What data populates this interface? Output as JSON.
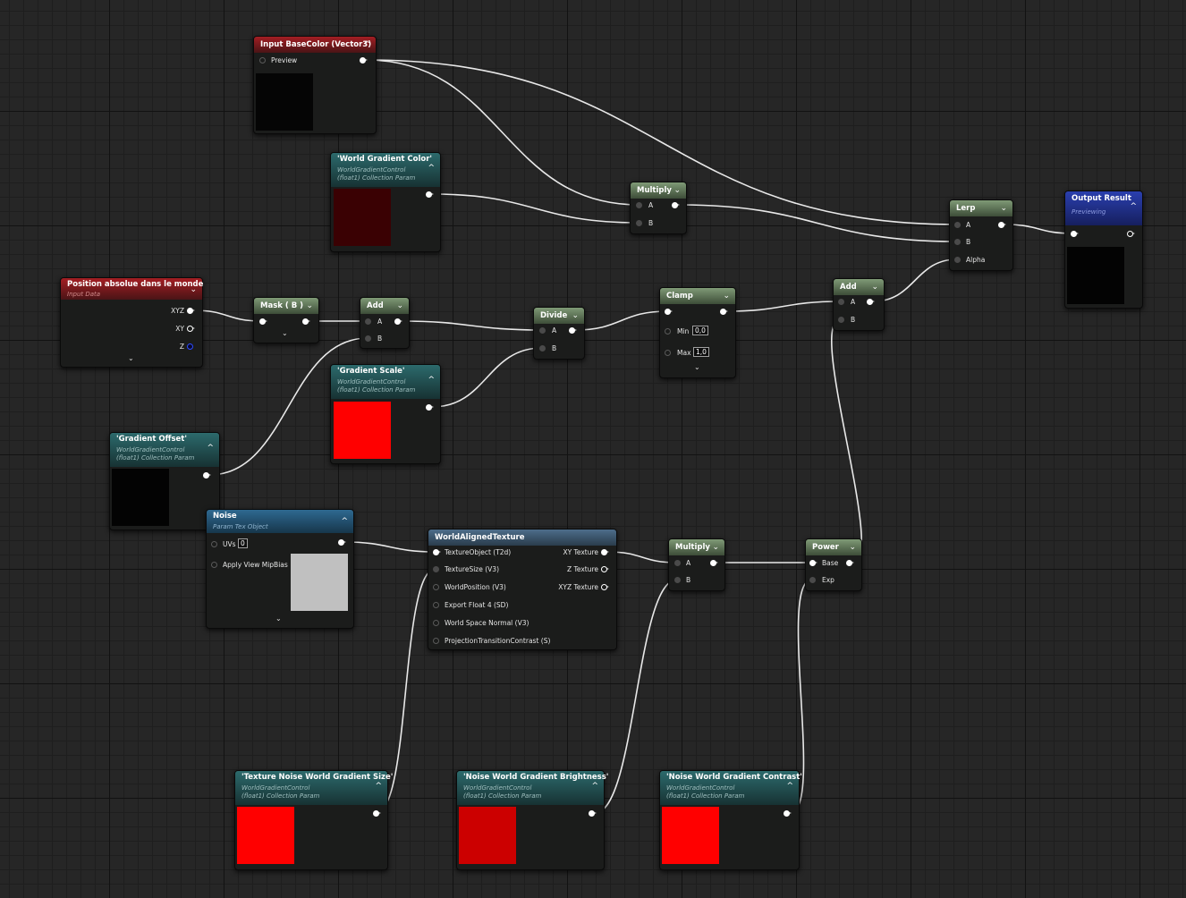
{
  "nodes": {
    "input_basecolor": {
      "title": "Input BaseColor (Vector3)",
      "pin_preview": "Preview",
      "swatch_color": "#050505"
    },
    "world_gradient_color": {
      "title": "'World Gradient Color'",
      "sub1": "WorldGradientControl",
      "sub2": "(float1) Collection Param",
      "swatch_color": "#3a0103"
    },
    "position_absolue": {
      "title": "Position absolue dans le monde",
      "sub1": "Input Data",
      "pin_xyz": "XYZ",
      "pin_xy": "XY",
      "pin_z": "Z"
    },
    "mask": {
      "title": "Mask ( B )"
    },
    "add1": {
      "title": "Add",
      "pin_a": "A",
      "pin_b": "B"
    },
    "divide": {
      "title": "Divide",
      "pin_a": "A",
      "pin_b": "B"
    },
    "clamp": {
      "title": "Clamp",
      "pin_min": "Min",
      "min_value": "0,0",
      "pin_max": "Max",
      "max_value": "1,0"
    },
    "add2": {
      "title": "Add",
      "pin_a": "A",
      "pin_b": "B"
    },
    "multiply1": {
      "title": "Multiply",
      "pin_a": "A",
      "pin_b": "B"
    },
    "lerp": {
      "title": "Lerp",
      "pin_a": "A",
      "pin_b": "B",
      "pin_alpha": "Alpha"
    },
    "output_result": {
      "title": "Output Result",
      "sub1": "Previewing",
      "swatch_color": "#030303"
    },
    "gradient_scale": {
      "title": "'Gradient Scale'",
      "sub1": "WorldGradientControl",
      "sub2": "(float1) Collection Param",
      "swatch_color": "#ff0000"
    },
    "gradient_offset": {
      "title": "'Gradient Offset'",
      "sub1": "WorldGradientControl",
      "sub2": "(float1) Collection Param",
      "swatch_color": "#030303"
    },
    "noise": {
      "title": "Noise",
      "sub1": "Param Tex Object",
      "pin_uvs": "UVs",
      "uvs_value": "0",
      "pin_mip": "Apply View MipBias",
      "swatch_color": "#c0c0c0"
    },
    "world_aligned_texture": {
      "title": "WorldAlignedTexture",
      "inputs": [
        "TextureObject (T2d)",
        "TextureSize (V3)",
        "WorldPosition (V3)",
        "Export Float 4 (SD)",
        "World Space Normal (V3)",
        "ProjectionTransitionContrast (S)"
      ],
      "outputs": [
        "XY Texture",
        "Z Texture",
        "XYZ Texture"
      ]
    },
    "multiply2": {
      "title": "Multiply",
      "pin_a": "A",
      "pin_b": "B"
    },
    "power": {
      "title": "Power",
      "pin_base": "Base",
      "pin_exp": "Exp"
    },
    "tex_noise_size": {
      "title": "'Texture Noise World Gradient Size'",
      "sub1": "WorldGradientControl",
      "sub2": "(float1) Collection Param",
      "swatch_color": "#ff0000"
    },
    "noise_brightness": {
      "title": "'Noise World Gradient Brightness'",
      "sub1": "WorldGradientControl",
      "sub2": "(float1) Collection Param",
      "swatch_color": "#cc0000"
    },
    "noise_contrast": {
      "title": "'Noise World Gradient Contrast'",
      "sub1": "WorldGradientControl",
      "sub2": "(float1) Collection Param",
      "swatch_color": "#ff0000"
    }
  }
}
